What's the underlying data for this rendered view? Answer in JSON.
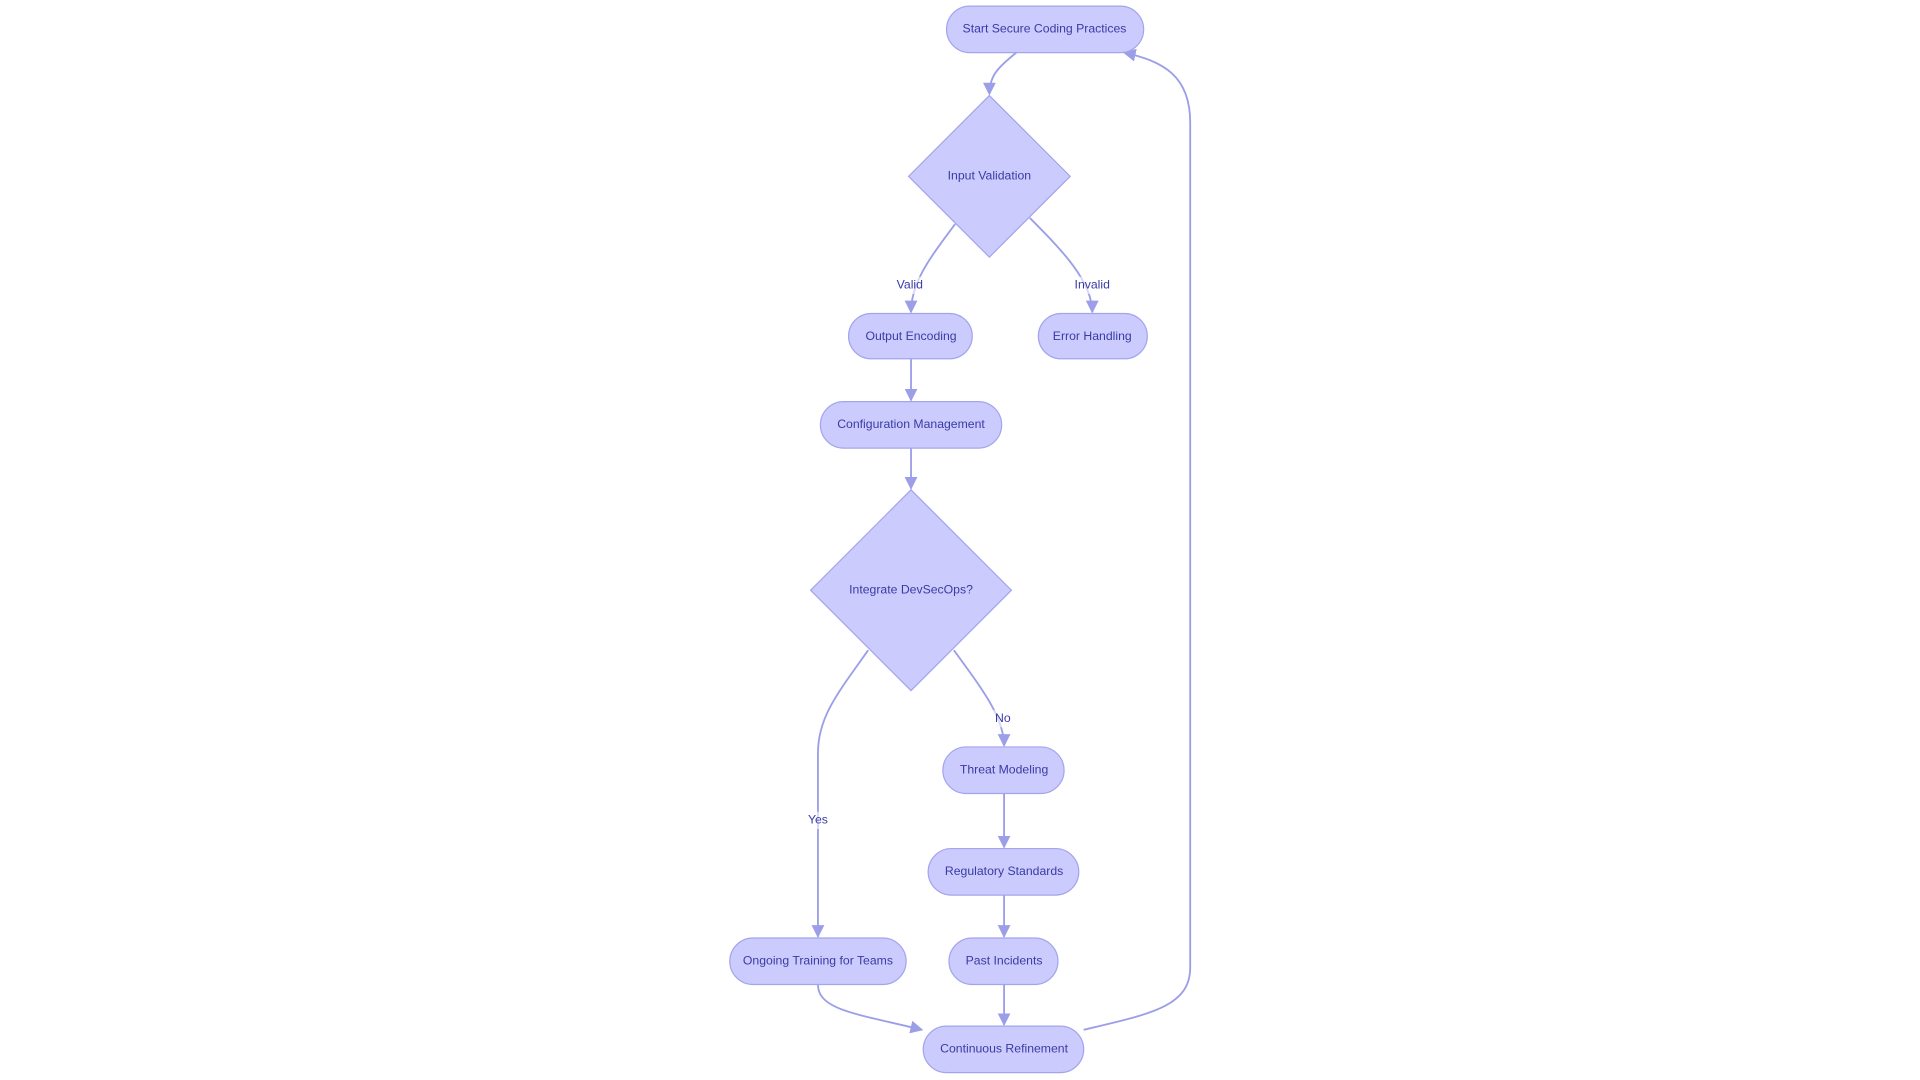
{
  "diagram": {
    "type": "flowchart",
    "colors": {
      "node_fill": "#cbcbfd",
      "node_stroke": "#a3a5ec",
      "edge": "#9c9ee8",
      "text": "#3a3aa6"
    },
    "nodes": {
      "start": "Start Secure Coding Practices",
      "input_validation": "Input Validation",
      "output_encoding": "Output Encoding",
      "error_handling": "Error Handling",
      "config_management": "Configuration Management",
      "devsecops": "Integrate DevSecOps?",
      "threat_modeling": "Threat Modeling",
      "regulatory": "Regulatory Standards",
      "past_incidents": "Past Incidents",
      "training": "Ongoing Training for Teams",
      "refinement": "Continuous Refinement"
    },
    "edge_labels": {
      "valid": "Valid",
      "invalid": "Invalid",
      "yes": "Yes",
      "no": "No"
    }
  }
}
